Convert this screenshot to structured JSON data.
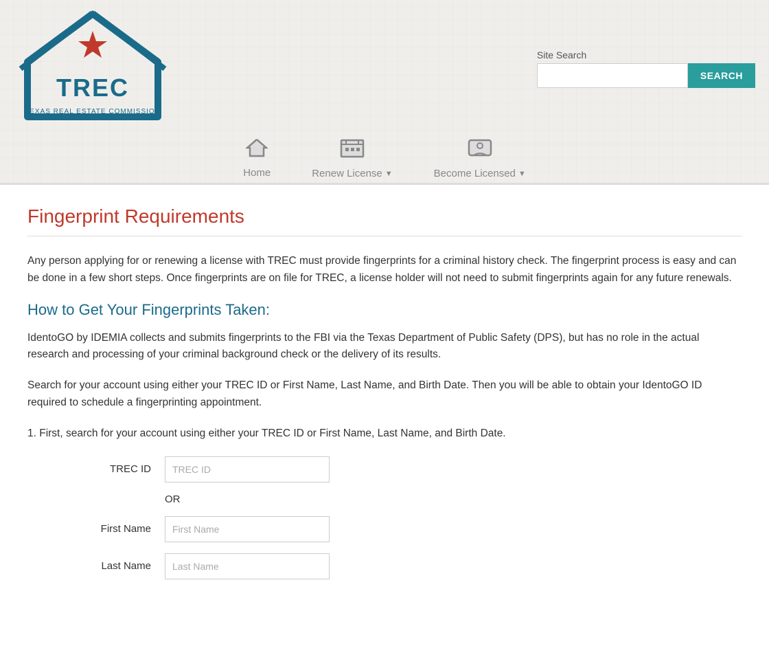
{
  "header": {
    "logo_alt": "TREC - Texas Real Estate Commission",
    "search_label": "Site Search",
    "search_placeholder": "",
    "search_button": "SEARCH"
  },
  "nav": {
    "items": [
      {
        "id": "home",
        "label": "Home",
        "icon": "🏠",
        "has_dropdown": false
      },
      {
        "id": "renew-license",
        "label": "Renew License",
        "icon": "📋",
        "has_dropdown": true
      },
      {
        "id": "become-licensed",
        "label": "Become Licensed",
        "icon": "💬",
        "has_dropdown": true
      }
    ]
  },
  "page": {
    "title": "Fingerprint Requirements",
    "intro_paragraph": "Any person applying for or renewing a license with TREC must provide fingerprints for a criminal history check. The fingerprint process is easy and can be done in a few short steps. Once fingerprints are on file for TREC, a license holder will not need to submit fingerprints again for any future renewals.",
    "section_title": "How to Get Your Fingerprints Taken:",
    "identogo_paragraph": "IdentoGO by IDEMIA collects and submits fingerprints to the FBI via the Texas Department of Public Safety (DPS), but has no role in the actual research and processing of your criminal background check or the delivery of its results.",
    "search_instructions": "Search for your account using either your TREC ID or First Name, Last Name, and Birth Date. Then you will be able to obtain your IdentoGO ID required to schedule a fingerprinting appointment.",
    "step1_text": "1. First, search for your account using either your TREC ID or First Name, Last Name, and Birth Date."
  },
  "form": {
    "trec_id_label": "TREC ID",
    "trec_id_placeholder": "TREC ID",
    "or_text": "OR",
    "first_name_label": "First Name",
    "first_name_placeholder": "First Name",
    "last_name_label": "Last Name",
    "last_name_placeholder": "Last Name"
  }
}
